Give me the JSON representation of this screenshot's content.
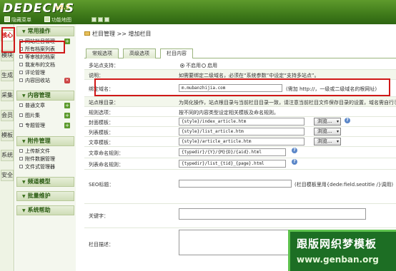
{
  "header": {
    "logo": "DEDECMS",
    "version": "v5.7",
    "toolbar": [
      "隐藏菜单",
      "功能地图"
    ]
  },
  "left_tabs": [
    "核心",
    "模块",
    "生成",
    "采集",
    "会员",
    "模板",
    "系统",
    "安全"
  ],
  "menu": {
    "sections": [
      {
        "title": "常用操作",
        "items": [
          "网站栏目管理",
          "所有档案列表",
          "等审核的档案",
          "我发布的文档",
          "评论管理",
          "内容回收站"
        ]
      },
      {
        "title": "内容管理",
        "items": [
          "普通文章",
          "图片集",
          "专题管理"
        ]
      },
      {
        "title": "附件管理",
        "items": [
          "上传新文件",
          "附件数据管理",
          "文件式管理器"
        ]
      },
      {
        "title": "频道模型",
        "items": []
      },
      {
        "title": "批量维护",
        "items": []
      },
      {
        "title": "系统帮助",
        "items": []
      }
    ]
  },
  "breadcrumb": {
    "part1": "栏目管理",
    "sep": ">>",
    "part2": "增加栏目"
  },
  "tabs": [
    "常规选项",
    "高级选项",
    "栏目内容"
  ],
  "form": {
    "multisite_label": "多站点支持：",
    "multisite_off": "不启用",
    "multisite_on": "启用",
    "note_label": "说明：",
    "note_text": "如需要绑定二级域名，必须在“系统参数”中设定“支持多站点”。",
    "domain_label": "绑定域名：",
    "domain_value": "m.mubanzhijia.com",
    "domain_hint": "(需加 http://，一级或二级域名的根网址)",
    "rootdir_label": "站点根目录：",
    "rootdir_text": "为简化操作，站点根目录与当前栏目目录一致，请注意当前栏目文件保存目录的设置，域名需自行手",
    "rule_label": "规则选项：",
    "rule_text": "按不同的内容类型设定相关模板及命名规则。",
    "index_tpl_label": "封面模板：",
    "index_tpl_value": "{style}/index_article.htm",
    "list_tpl_label": "列表模板：",
    "list_tpl_value": "{style}/list_article.htm",
    "article_tpl_label": "文章模板：",
    "article_tpl_value": "{style}/article_article.htm",
    "browse_label": "浏览...",
    "article_rule_label": "文章命名规则：",
    "article_rule_value": "{typedir}/{Y}/{M}{D}/{aid}.html",
    "list_rule_label": "列表命名规则：",
    "list_rule_value": "{typedir}/list_{tid}_{page}.html",
    "seo_title_label": "SEO标题：",
    "seo_title_hint": "(栏目模板里用{dede:field.seotitle /}调用)",
    "keywords_label": "关键字：",
    "desc_label": "栏目描述："
  },
  "watermark": {
    "line1": "跟版网织梦模板",
    "line2": "www.genban.org"
  }
}
